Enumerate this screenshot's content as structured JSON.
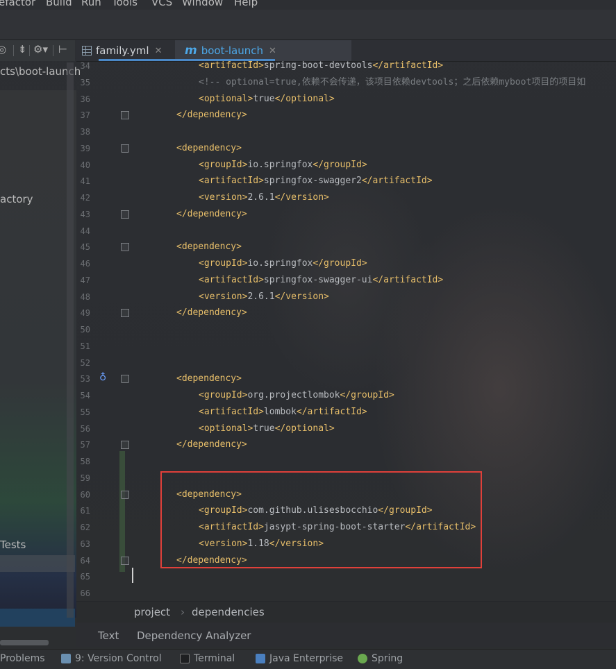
{
  "menu": [
    "efactor",
    "Build",
    "Run",
    "Tools",
    "VCS",
    "Window",
    "Help"
  ],
  "project_panel": {
    "path_fragment": "cts\\boot-launch",
    "tree_items": [
      "actory",
      "Tests"
    ]
  },
  "tabs": [
    {
      "label": "family.yml",
      "icon": "table-icon"
    },
    {
      "label": "boot-launch",
      "icon": "maven-icon"
    }
  ],
  "editor": {
    "lines": [
      {
        "n": "34",
        "indent": 2,
        "parts": [
          [
            "tag",
            "<artifactId>"
          ],
          [
            "txt",
            "spring-boot-devtools"
          ],
          [
            "tag",
            "</artifactId>"
          ]
        ]
      },
      {
        "n": "35",
        "indent": 2,
        "parts": [
          [
            "cmt",
            "<!-- optional=true,依赖不会传递，该项目依赖devtools；之后依赖myboot项目的项目如"
          ]
        ]
      },
      {
        "n": "36",
        "indent": 2,
        "parts": [
          [
            "tag",
            "<optional>"
          ],
          [
            "txt",
            "true"
          ],
          [
            "tag",
            "</optional>"
          ]
        ]
      },
      {
        "n": "37",
        "indent": 1,
        "parts": [
          [
            "tag",
            "</dependency>"
          ]
        ]
      },
      {
        "n": "38",
        "indent": 0,
        "parts": []
      },
      {
        "n": "39",
        "indent": 1,
        "parts": [
          [
            "tag",
            "<dependency>"
          ]
        ]
      },
      {
        "n": "40",
        "indent": 2,
        "parts": [
          [
            "tag",
            "<groupId>"
          ],
          [
            "txt",
            "io.springfox"
          ],
          [
            "tag",
            "</groupId>"
          ]
        ]
      },
      {
        "n": "41",
        "indent": 2,
        "parts": [
          [
            "tag",
            "<artifactId>"
          ],
          [
            "txt",
            "springfox-swagger2"
          ],
          [
            "tag",
            "</artifactId>"
          ]
        ]
      },
      {
        "n": "42",
        "indent": 2,
        "parts": [
          [
            "tag",
            "<version>"
          ],
          [
            "txt",
            "2.6.1"
          ],
          [
            "tag",
            "</version>"
          ]
        ]
      },
      {
        "n": "43",
        "indent": 1,
        "parts": [
          [
            "tag",
            "</dependency>"
          ]
        ]
      },
      {
        "n": "44",
        "indent": 0,
        "parts": []
      },
      {
        "n": "45",
        "indent": 1,
        "parts": [
          [
            "tag",
            "<dependency>"
          ]
        ]
      },
      {
        "n": "46",
        "indent": 2,
        "parts": [
          [
            "tag",
            "<groupId>"
          ],
          [
            "txt",
            "io.springfox"
          ],
          [
            "tag",
            "</groupId>"
          ]
        ]
      },
      {
        "n": "47",
        "indent": 2,
        "parts": [
          [
            "tag",
            "<artifactId>"
          ],
          [
            "txt",
            "springfox-swagger-ui"
          ],
          [
            "tag",
            "</artifactId>"
          ]
        ]
      },
      {
        "n": "48",
        "indent": 2,
        "parts": [
          [
            "tag",
            "<version>"
          ],
          [
            "txt",
            "2.6.1"
          ],
          [
            "tag",
            "</version>"
          ]
        ]
      },
      {
        "n": "49",
        "indent": 1,
        "parts": [
          [
            "tag",
            "</dependency>"
          ]
        ]
      },
      {
        "n": "50",
        "indent": 0,
        "parts": []
      },
      {
        "n": "51",
        "indent": 0,
        "parts": []
      },
      {
        "n": "52",
        "indent": 0,
        "parts": []
      },
      {
        "n": "53",
        "indent": 1,
        "parts": [
          [
            "tag",
            "<dependency>"
          ]
        ]
      },
      {
        "n": "54",
        "indent": 2,
        "parts": [
          [
            "tag",
            "<groupId>"
          ],
          [
            "txt",
            "org.projectlombok"
          ],
          [
            "tag",
            "</groupId>"
          ]
        ]
      },
      {
        "n": "55",
        "indent": 2,
        "parts": [
          [
            "tag",
            "<artifactId>"
          ],
          [
            "txt",
            "lombok"
          ],
          [
            "tag",
            "</artifactId>"
          ]
        ]
      },
      {
        "n": "56",
        "indent": 2,
        "parts": [
          [
            "tag",
            "<optional>"
          ],
          [
            "txt",
            "true"
          ],
          [
            "tag",
            "</optional>"
          ]
        ]
      },
      {
        "n": "57",
        "indent": 1,
        "parts": [
          [
            "tag",
            "</dependency>"
          ]
        ]
      },
      {
        "n": "58",
        "indent": 0,
        "parts": []
      },
      {
        "n": "59",
        "indent": 0,
        "parts": []
      },
      {
        "n": "60",
        "indent": 1,
        "parts": [
          [
            "tag",
            "<dependency>"
          ]
        ]
      },
      {
        "n": "61",
        "indent": 2,
        "parts": [
          [
            "tag",
            "<groupId>"
          ],
          [
            "txt",
            "com.github.ulisesbocchio"
          ],
          [
            "tag",
            "</groupId>"
          ]
        ]
      },
      {
        "n": "62",
        "indent": 2,
        "parts": [
          [
            "tag",
            "<artifactId>"
          ],
          [
            "txt",
            "jasypt-spring-boot-starter"
          ],
          [
            "tag",
            "</artifactId>"
          ]
        ]
      },
      {
        "n": "63",
        "indent": 2,
        "parts": [
          [
            "tag",
            "<version>"
          ],
          [
            "txt",
            "1.18"
          ],
          [
            "tag",
            "</version>"
          ]
        ]
      },
      {
        "n": "64",
        "indent": 1,
        "parts": [
          [
            "tag",
            "</dependency>"
          ]
        ]
      },
      {
        "n": "65",
        "indent": 0,
        "parts": []
      },
      {
        "n": "66",
        "indent": 0,
        "parts": []
      }
    ]
  },
  "breadcrumb": [
    "project",
    "dependencies"
  ],
  "editor_bottom_tabs": [
    "Text",
    "Dependency Analyzer"
  ],
  "tool_windows": [
    {
      "label": "Problems",
      "icon": "problems-icon",
      "color": "#b07a3a"
    },
    {
      "label": "9: Version Control",
      "icon": "version-control-icon",
      "color": "#6a8fb0"
    },
    {
      "label": "Terminal",
      "icon": "terminal-icon",
      "color": "#3c3f41"
    },
    {
      "label": "Java Enterprise",
      "icon": "java-enterprise-icon",
      "color": "#4a7fbf"
    },
    {
      "label": "Spring",
      "icon": "spring-icon",
      "color": "#6aa84f"
    }
  ]
}
